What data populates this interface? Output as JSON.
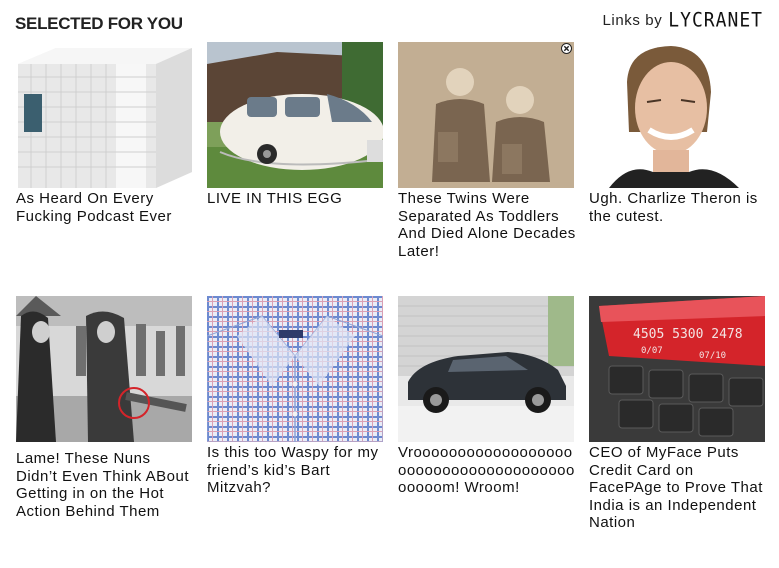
{
  "header": {
    "title": "SELECTED FOR YOU",
    "links_by": "Links by",
    "brand": "LYCRANET"
  },
  "cards": [
    {
      "caption": "As Heard On Every Fucking Podcast Ever",
      "image": "white mattress product"
    },
    {
      "caption": "LIVE IN THIS EGG",
      "image": "egg-shaped camper trailer"
    },
    {
      "caption": "These Twins Were Separated As Toddlers And Died Alone Decades Later!",
      "image": "vintage photo of twin boys"
    },
    {
      "caption": "Ugh. Charlize Theron is the cutest.",
      "image": "smiling woman portrait"
    },
    {
      "caption": "Lame! These Nuns Didn’t Even Think ABout Getting in on the Hot Action Behind Them",
      "image": "nuns at outdoor festival, black and white"
    },
    {
      "caption": "Is this too Waspy for my friend’s kid’s Bart Mitzvah?",
      "image": "blue plaid dress shirt"
    },
    {
      "caption": "Vrooooooooooooooooooooooooooooooooooooooooooom! Wroom!",
      "image": "dark grey sedan by a wall"
    },
    {
      "caption": "CEO of MyFace Puts Credit Card on FacePAge to Prove That India is an Independent Nation",
      "image": "credit card on keyboard"
    }
  ],
  "credit_card_text": {
    "number": "4505 5300 2478",
    "small": "0/07",
    "exp": "07/10"
  },
  "colors": {
    "accent_red": "#d4242a",
    "shirt_blue": "#5b7fc4",
    "sky": "#cfd9e3"
  }
}
